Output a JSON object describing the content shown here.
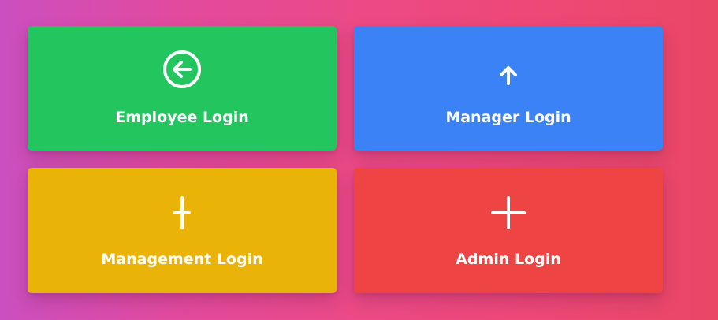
{
  "cards": [
    {
      "label": "Employee Login",
      "icon": "arrow-left-circle-icon",
      "color": "#22c55e"
    },
    {
      "label": "Manager Login",
      "icon": "arrow-up-icon",
      "color": "#3b82f6"
    },
    {
      "label": "Management Login",
      "icon": "plus-icon",
      "color": "#eab308"
    },
    {
      "label": "Admin Login",
      "icon": "plus-icon",
      "color": "#ef4444"
    }
  ],
  "background": {
    "gradient_start": "#cb4fc0",
    "gradient_end": "#ea4766"
  }
}
